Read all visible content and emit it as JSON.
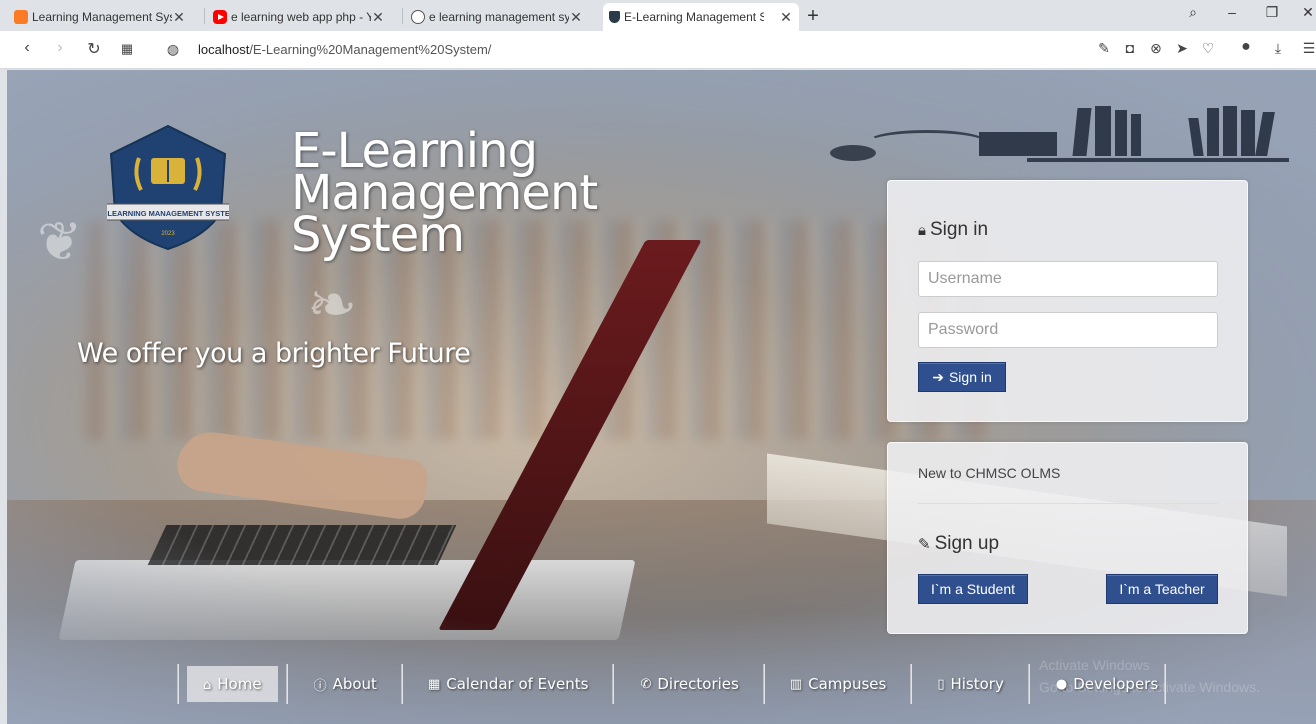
{
  "browser": {
    "tabs": [
      {
        "title": "Learning Management Syst",
        "favicon": "xampp-icon",
        "active": false
      },
      {
        "title": "e learning web app php - Y",
        "favicon": "youtube-icon",
        "active": false
      },
      {
        "title": "e learning management sys",
        "favicon": "globe-icon",
        "active": false
      },
      {
        "title": "E-Learning Management Sy",
        "favicon": "shield-icon",
        "active": true
      }
    ],
    "url_host": "localhost",
    "url_path": "/E-Learning%20Management%20System/"
  },
  "hero": {
    "logo_banner_text": "E-LEARNING MANAGEMENT SYSTEM",
    "logo_year": "2023",
    "title_line1": "E-Learning",
    "title_line2": "Management",
    "title_line3": "System",
    "tagline": "We offer you a brighter Future"
  },
  "signin": {
    "heading": "Sign in",
    "username_placeholder": "Username",
    "password_placeholder": "Password",
    "button_label": "Sign in"
  },
  "signup": {
    "new_to_text": "New to CHMSC OLMS",
    "heading": "Sign up",
    "student_button": "I`m a Student",
    "teacher_button": "I`m a Teacher"
  },
  "nav": {
    "items": [
      {
        "label": "Home",
        "icon": "home-icon",
        "active": true
      },
      {
        "label": "About",
        "icon": "info-icon",
        "active": false
      },
      {
        "label": "Calendar of Events",
        "icon": "calendar-icon",
        "active": false
      },
      {
        "label": "Directories",
        "icon": "phone-icon",
        "active": false
      },
      {
        "label": "Campuses",
        "icon": "building-icon",
        "active": false
      },
      {
        "label": "History",
        "icon": "file-icon",
        "active": false
      },
      {
        "label": "Developers",
        "icon": "user-icon",
        "active": false
      }
    ]
  },
  "watermark": {
    "line1": "Activate Windows",
    "line2": "Go to Settings to activate Windows."
  },
  "colors": {
    "button_blue": "#2f4f8f",
    "card_bg": "#f0f0f2",
    "logo_navy": "#1f4272",
    "logo_gold": "#d9b23a"
  }
}
